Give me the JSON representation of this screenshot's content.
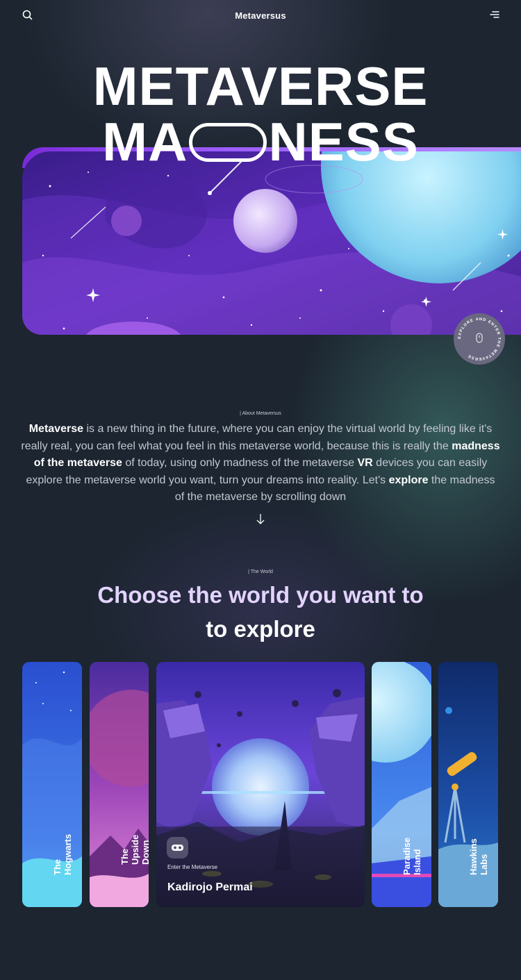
{
  "header": {
    "brand": "Metaversus",
    "search_icon": "search-icon",
    "menu_icon": "menu-icon"
  },
  "hero": {
    "title_line1": "METAVERSE",
    "title_line2_left": "MA",
    "title_line2_right": "NESS",
    "badge_text": "EXPLORE AND ENTER THE METAVERSE",
    "accent": "#8f45ff"
  },
  "about": {
    "label": "| About Metaversus",
    "p1_bold": "Metaverse",
    "p1_rest": " is a new thing in the future, where you can enjoy the virtual world by feeling like it's really real, you can feel what you feel in this metaverse world, because this is really the ",
    "p2_bold": "madness of the metaverse",
    "p2_rest": " of today, using only madness of the metaverse ",
    "p3_bold": "VR",
    "p3_rest": " devices you can easily explore the metaverse world you want, turn your dreams into reality. Let's ",
    "p4_bold": "explore",
    "p4_rest": " the madness of the metaverse by scrolling down",
    "arrow_icon": "arrow-down-icon"
  },
  "world": {
    "label": "| The World",
    "title_line1": "Choose the world you want to",
    "title_line2": "to explore",
    "cards": [
      {
        "label": "The\nHogwarts"
      },
      {
        "label": "The Upside\nDown"
      },
      {
        "sub": "Enter the Metaverse",
        "name": "Kadirojo Permai",
        "icon": "vr-headset-icon"
      },
      {
        "label": "Paradise\nIsland"
      },
      {
        "label": "Hawkins\nLabs"
      }
    ]
  }
}
